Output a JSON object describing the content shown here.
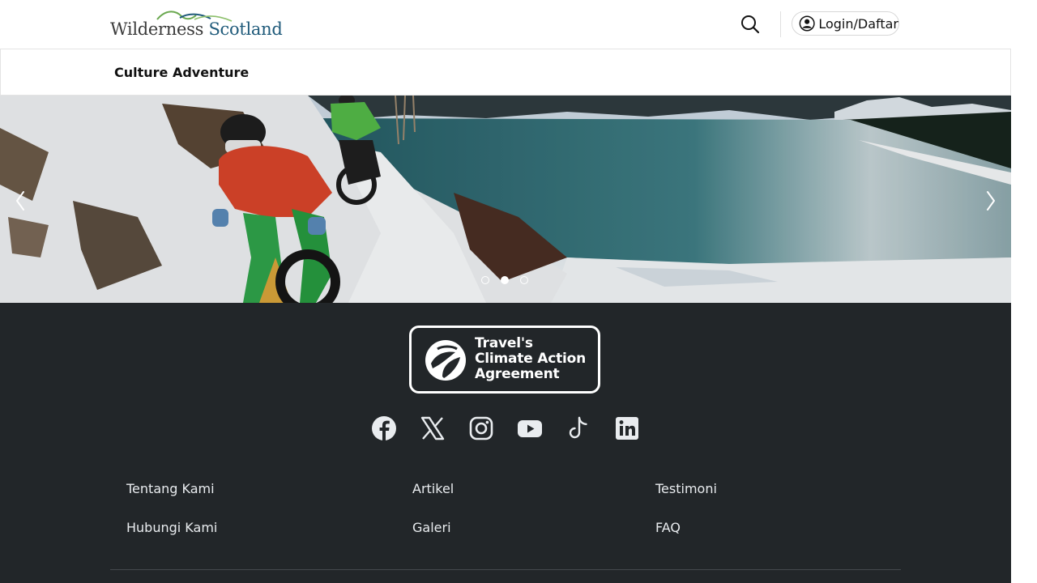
{
  "header": {
    "logo": {
      "text_part1": "Wilderness",
      "text_part2": "Scotland"
    },
    "search_icon": "search-icon",
    "login_label": "Login/Daftar",
    "login_icon": "user-circle-icon"
  },
  "subnav": {
    "title": "Culture Adventure"
  },
  "hero": {
    "prev_icon": "chevron-left-icon",
    "next_icon": "chevron-right-icon",
    "slides_count": 3,
    "active_slide": 2
  },
  "footer": {
    "badge": {
      "line1": "Travel's",
      "line2": "Climate Action",
      "line3": "Agreement"
    },
    "socials": [
      "facebook-icon",
      "x-icon",
      "instagram-icon",
      "youtube-icon",
      "tiktok-icon",
      "linkedin-icon"
    ],
    "links": {
      "col1": [
        "Tentang Kami",
        "Hubungi Kami"
      ],
      "col2": [
        "Artikel",
        "Galeri"
      ],
      "col3": [
        "Testimoni",
        "FAQ"
      ]
    }
  },
  "colors": {
    "footer_bg": "#222629",
    "logo_accent": "#1f5a7a",
    "logo_swoosh_green": "#6aa84f"
  }
}
